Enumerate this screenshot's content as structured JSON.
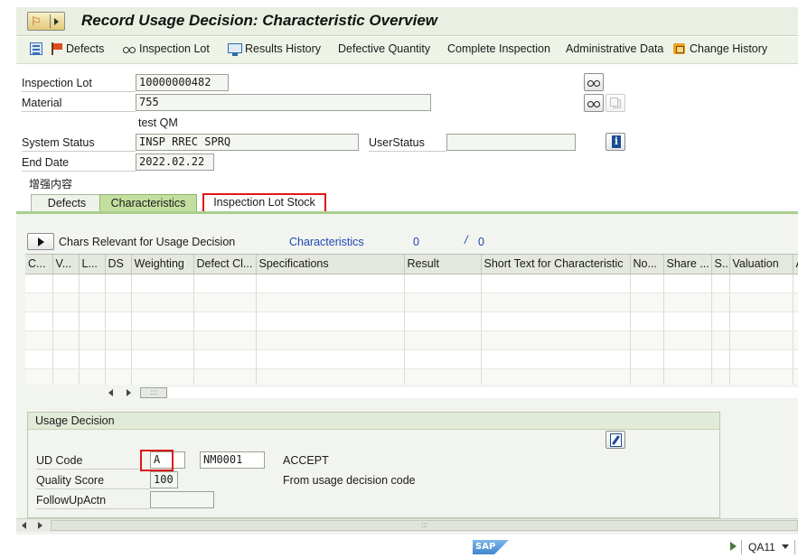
{
  "title": "Record Usage Decision: Characteristic Overview",
  "toolbar": {
    "defects": "Defects",
    "inspection_lot": "Inspection Lot",
    "results_history": "Results History",
    "defective_quantity": "Defective Quantity",
    "complete_inspection": "Complete Inspection",
    "administrative_data": "Administrative Data",
    "change_history": "Change History"
  },
  "header": {
    "inspection_lot_label": "Inspection Lot",
    "inspection_lot_value": "10000000482",
    "material_label": "Material",
    "material_value": "755",
    "material_desc": "test QM",
    "system_status_label": "System Status",
    "system_status_value": "INSP RREC SPRQ",
    "user_status_label": "UserStatus",
    "user_status_value": "",
    "end_date_label": "End Date",
    "end_date_value": "2022.02.22",
    "enhanced_content": "增强内容"
  },
  "tabs": [
    {
      "label": "Defects",
      "active": false
    },
    {
      "label": "Characteristics",
      "active": true
    },
    {
      "label": "Inspection Lot Stock",
      "active": false
    }
  ],
  "chars": {
    "section_label": "Chars Relevant for Usage Decision",
    "link_label": "Characteristics",
    "count": "0",
    "separator": "/",
    "total": "0",
    "columns": [
      "C...",
      "V...",
      "L...",
      "DS",
      "Weighting",
      "Defect Cl...",
      "Specifications",
      "Result",
      "Short Text for Characteristic",
      "No...",
      "Share ...",
      "S..",
      "Valuation",
      "A"
    ],
    "empty_rows": 6
  },
  "usage_decision": {
    "title": "Usage Decision",
    "ud_code_label": "UD Code",
    "ud_code_value": "A",
    "ud_code_group": "NM0001",
    "ud_code_text": "ACCEPT",
    "quality_score_label": "Quality Score",
    "quality_score_value": "100",
    "quality_score_text": "From usage decision code",
    "follow_up_label": "FollowUpActn",
    "follow_up_value": ""
  },
  "statusbar": {
    "logo_text": "SAP",
    "transaction": "QA11"
  },
  "colors": {
    "active_tab": "#c3df9f",
    "title_bar": "#e9efe2",
    "highlight_red": "#e01616",
    "link_blue": "#1f47b5"
  }
}
